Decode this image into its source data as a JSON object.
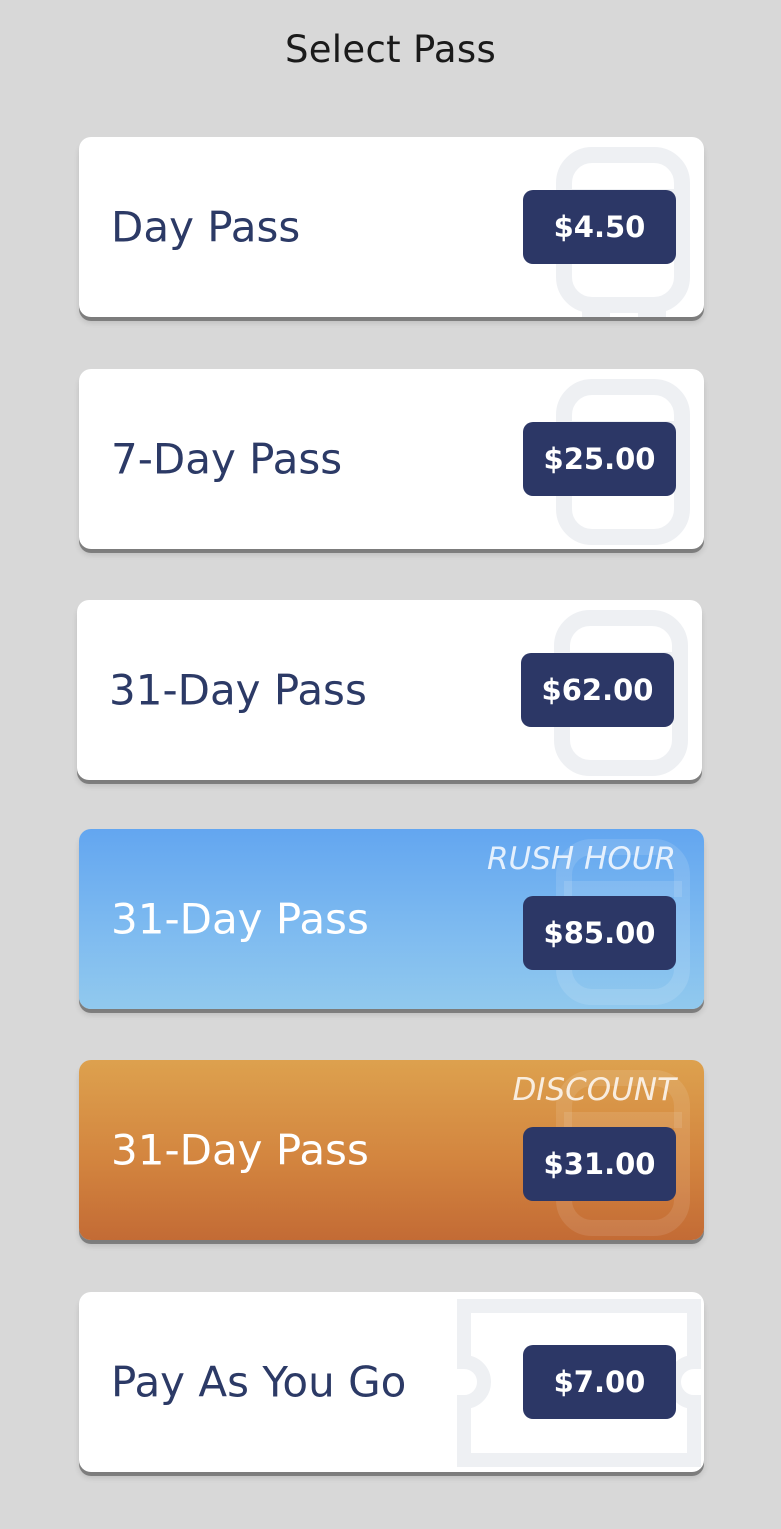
{
  "header": {
    "title": "Select Pass"
  },
  "passes": [
    {
      "label": "Day Pass",
      "price": "$4.50",
      "tag": "",
      "style": "white",
      "icon": "bus-icon"
    },
    {
      "label": "7-Day Pass",
      "price": "$25.00",
      "tag": "",
      "style": "white",
      "icon": "bus-icon"
    },
    {
      "label": "31-Day Pass",
      "price": "$62.00",
      "tag": "",
      "style": "white",
      "icon": "bus-icon"
    },
    {
      "label": "31-Day Pass",
      "price": "$85.00",
      "tag": "RUSH HOUR",
      "style": "blue",
      "icon": "bus-icon"
    },
    {
      "label": "31-Day Pass",
      "price": "$31.00",
      "tag": "DISCOUNT",
      "style": "orange",
      "icon": "bus-icon"
    },
    {
      "label": "Pay As You Go",
      "price": "$7.00",
      "tag": "",
      "style": "white",
      "icon": "ticket-icon"
    }
  ],
  "colors": {
    "background": "#d8d8d8",
    "card": "#ffffff",
    "price_badge": "#2c3766",
    "label_text": "#2c3a66",
    "rush_hour_gradient": [
      "#63a6f0",
      "#91c9ee"
    ],
    "discount_gradient": [
      "#dda14e",
      "#c36b35"
    ]
  }
}
